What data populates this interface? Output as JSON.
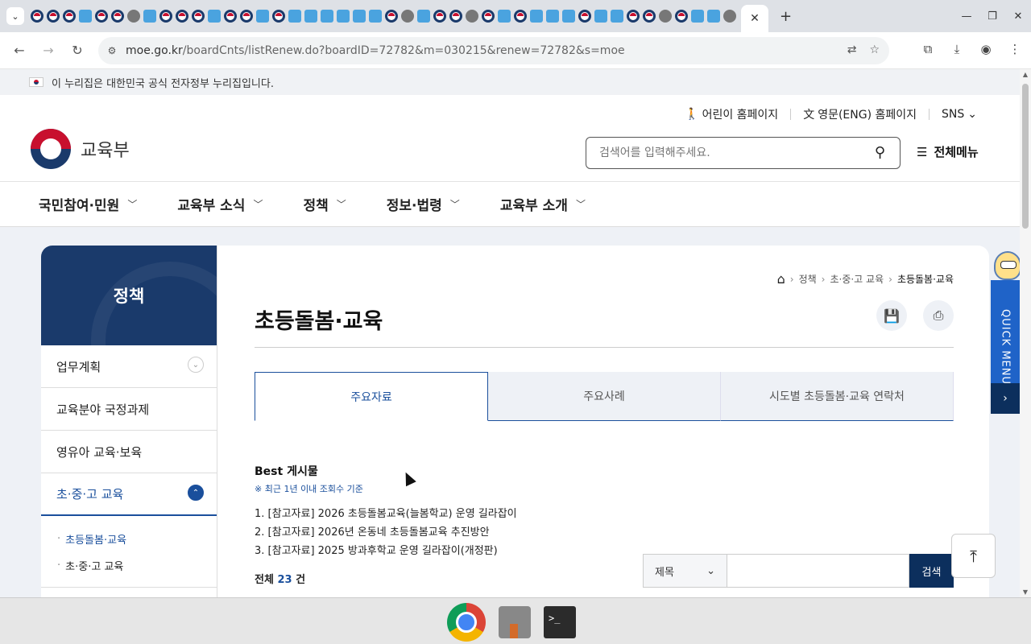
{
  "browser": {
    "url_host": "moe.go.kr",
    "url_path": "/boardCnts/listRenew.do?boardID=72782&m=030215&renew=72782&s=moe",
    "active_tab_close": "✕",
    "new_tab": "+"
  },
  "gov_banner": {
    "text": "이 누리집은 대한민국 공식 전자정부 누리집입니다."
  },
  "header": {
    "util": {
      "kids": "어린이 홈페이지",
      "english": "영문(ENG) 홈페이지",
      "sns": "SNS"
    },
    "logo_text": "교육부",
    "search_placeholder": "검색어를 입력해주세요.",
    "all_menu": "전체메뉴"
  },
  "gnb": {
    "items": [
      {
        "label": "국민참여·민원"
      },
      {
        "label": "교육부 소식"
      },
      {
        "label": "정책"
      },
      {
        "label": "정보·법령"
      },
      {
        "label": "교육부 소개"
      }
    ]
  },
  "lnb": {
    "title": "정책",
    "items": [
      {
        "label": "업무계획"
      },
      {
        "label": "교육분야 국정과제"
      },
      {
        "label": "영유아 교육·보육"
      },
      {
        "label": "초·중·고 교육"
      }
    ],
    "sub_items": [
      {
        "label": "초등돌봄·교육"
      },
      {
        "label": "초·중·고 교육"
      }
    ]
  },
  "breadcrumb": {
    "items": [
      "정책",
      "초·중·고 교육",
      "초등돌봄·교육"
    ]
  },
  "main": {
    "title": "초등돌봄·교육",
    "tabs": [
      {
        "label": "주요자료"
      },
      {
        "label": "주요사례"
      },
      {
        "label": "시도별 초등돌봄·교육 연락처"
      }
    ],
    "best": {
      "title": "Best 게시물",
      "note": "※ 최근 1년 이내 조회수 기준",
      "items": [
        "1. [참고자료] 2026 초등돌봄교육(늘봄학교) 운영 길라잡이",
        "2. [참고자료] 2026년 온동네 초등돌봄교육 추진방안",
        "3. [참고자료] 2025 방과후학교 운영 길라잡이(개정판)"
      ]
    },
    "total_prefix": "전체",
    "total_count": "23",
    "total_suffix": "건",
    "search_field": "제목",
    "search_button": "검색"
  },
  "quick_menu": "QUICK MENU",
  "colors": {
    "primary": "#1a3a6b",
    "accent": "#1a4f9c",
    "quick": "#1f63c8"
  }
}
